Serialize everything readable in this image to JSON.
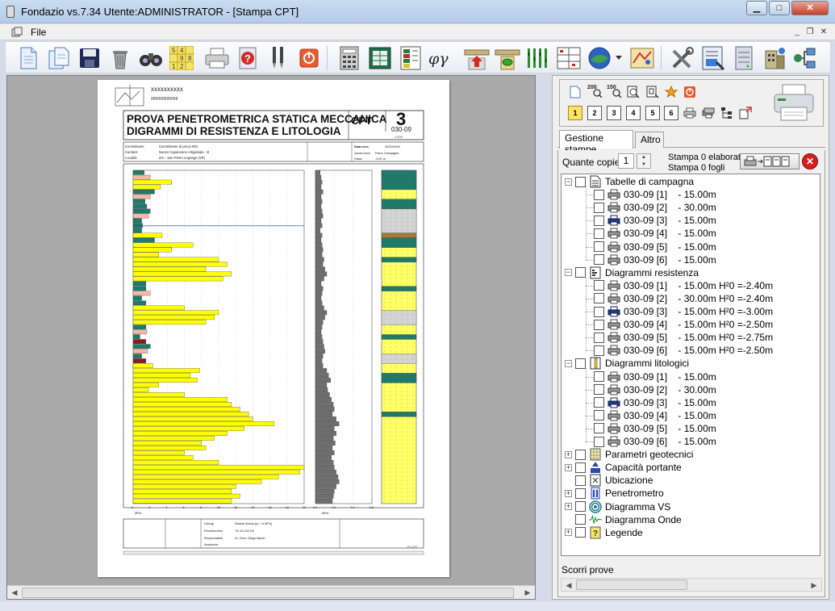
{
  "window": {
    "title": "Fondazio vs.7.34  Utente:ADMINISTRATOR - [Stampa CPT]",
    "minimize_label": "▁",
    "maximize_label": "□",
    "close_label": "✕"
  },
  "menu": {
    "file_label": "File",
    "mdi_minimize": "_",
    "mdi_restore": "❐",
    "mdi_close": "✕"
  },
  "toolbar": {
    "icons": [
      "new-page",
      "copy-pages",
      "save-disk",
      "trash",
      "binoculars",
      "sudoku-grid",
      "printer",
      "help-question",
      "probe-tool",
      "power-button",
      "calculator",
      "table-green",
      "stratigraphy",
      "phi-gamma",
      "penetrometer-red",
      "penetrometer-green",
      "grass-layers",
      "grid-table",
      "globe-dropdown",
      "map",
      "tools",
      "report",
      "server",
      "building",
      "network"
    ],
    "sudoku_digits": [
      "5",
      "4",
      "9",
      "8",
      "1",
      "2"
    ],
    "phi_gamma_label": "φγ"
  },
  "report": {
    "header_brand": "xxxxxxxxxx",
    "header_brand_sub": "gggggggggggg",
    "title_line1": "PROVA PENETROMETRICA STATICA MECCANICA",
    "title_line2": "DIGRAMMI DI RESISTENZA E LITOLOGIA",
    "cpt_label": "CPT",
    "cpt_number": "3",
    "doc_code": "030-09",
    "scale_label": "1:100",
    "committente_label": "Committente",
    "committente": "Committente di prova 000",
    "cantiere_label": "Cantiere",
    "cantiere": "Nuovo Capannone Artigianale - B",
    "localita_label": "Località",
    "localita": "ZAI - San Pietro Legnago (VR)",
    "data_label": "Data esec.",
    "data": "00/00/0000",
    "quota_label": "Quota inizio",
    "quota": "Piano Campagna",
    "falda_label": "Falda",
    "falda": "-3.00 m",
    "bottom_litologi_label": "Litologi",
    "bottom_litologi": "Sabbia limosa (rp = 8 MPa)",
    "bottom_penetrometro_label": "Penetrometro",
    "bottom_penetrometro": "TG 63-200 kN",
    "bottom_responsabile_label": "Responsabile",
    "bottom_responsabile": "Dr. Geol. Diego Martin",
    "bottom_assistente_label": "Assistente",
    "footer_code": "FC-CPT",
    "axis1_label": "MPa",
    "axis2_label": "MPa",
    "axis1_ticks": [
      "0",
      "2",
      "4",
      "6",
      "8",
      "10",
      "12",
      "14",
      "16",
      "18",
      "20"
    ],
    "axis2_ticks": [
      "0.0",
      "0.2",
      "0.4",
      "0.6"
    ],
    "qc_values": [
      1.3,
      2.0,
      4.5,
      3.2,
      2.5,
      2.0,
      1.4,
      1.6,
      2.0,
      1.8,
      1.0,
      1.1,
      1.0,
      3.4,
      2.5,
      7.0,
      4.5,
      3.0,
      10.0,
      11.0,
      8.5,
      11.5,
      10.5,
      1.5,
      1.5,
      2.0,
      1.0,
      1.5,
      6.0,
      10.0,
      9.5,
      8.5,
      1.5,
      1.6,
      0.8,
      1.5,
      2.0,
      1.7,
      1.0,
      1.5,
      2.3,
      7.8,
      6.7,
      7.5,
      3.0,
      1.8,
      6.0,
      11.0,
      11.5,
      12.5,
      13.5,
      14.0,
      16.5,
      13.0,
      11.0,
      9.5,
      8.0,
      8.5,
      6.0,
      7.0,
      10.0,
      20.0,
      19.5,
      17.0,
      15.0,
      12.0,
      11.5,
      12.5,
      11.5
    ],
    "fs_values": [
      0.05,
      0.06,
      0.07,
      0.06,
      0.08,
      0.06,
      0.07,
      0.06,
      0.07,
      0.08,
      0.06,
      0.07,
      0.05,
      0.07,
      0.06,
      0.07,
      0.08,
      0.07,
      0.09,
      0.08,
      0.1,
      0.12,
      0.09,
      0.06,
      0.08,
      0.07,
      0.06,
      0.07,
      0.09,
      0.12,
      0.1,
      0.08,
      0.07,
      0.06,
      0.07,
      0.08,
      0.09,
      0.1,
      0.08,
      0.07,
      0.08,
      0.12,
      0.14,
      0.16,
      0.12,
      0.13,
      0.15,
      0.17,
      0.19,
      0.2,
      0.18,
      0.22,
      0.25,
      0.2,
      0.22,
      0.19,
      0.21,
      0.18,
      0.2,
      0.17,
      0.19,
      0.2,
      0.22,
      0.24,
      0.25,
      0.22,
      0.2,
      0.19,
      0.18
    ]
  },
  "right_panel": {
    "tab_active": "Gestione stampe",
    "tab_other": "Altro",
    "copies_label": "Quante copie",
    "copies_value": "1",
    "stampa_elaborati": "Stampa 0 elaborati",
    "stampa_fogli": "Stampa 0 fogli",
    "panel_icons": [
      "page",
      "zoom-200",
      "zoom-150",
      "zoom-fit",
      "zoom-page",
      "star",
      "power"
    ],
    "zoom_labels": [
      "200",
      "150"
    ],
    "page_numbers": [
      "1",
      "2",
      "3",
      "4",
      "5",
      "6"
    ],
    "scorri_label": "Scorri prove",
    "tree": [
      {
        "label": "Tabelle di campagna",
        "expanded": true,
        "icon": "page-table-icon",
        "children": [
          "030-09 [1]    - 15.00m",
          "030-09 [2]    - 30.00m",
          "030-09 [3]    - 15.00m",
          "030-09 [4]    - 15.00m",
          "030-09 [5]    - 15.00m",
          "030-09 [6]    - 15.00m"
        ]
      },
      {
        "label": "Diagrammi resistenza",
        "expanded": true,
        "icon": "resistance-chart-icon",
        "children": [
          "030-09 [1]    - 15.00m H²0 =-2.40m",
          "030-09 [2]    - 30.00m H²0 =-2.40m",
          "030-09 [3]    - 15.00m H²0 =-3.00m",
          "030-09 [4]    - 15.00m H²0 =-2.50m",
          "030-09 [5]    - 15.00m H²0 =-2.75m",
          "030-09 [6]    - 15.00m H²0 =-2.50m"
        ]
      },
      {
        "label": "Diagrammi litologici",
        "expanded": true,
        "icon": "lithology-chart-icon",
        "children": [
          "030-09 [1]    - 15.00m",
          "030-09 [2]    - 30.00m",
          "030-09 [3]    - 15.00m",
          "030-09 [4]    - 15.00m",
          "030-09 [5]    - 15.00m",
          "030-09 [6]    - 15.00m"
        ]
      },
      {
        "label": "Parametri geotecnici",
        "expanded": false,
        "icon": "geotech-params-icon",
        "children": []
      },
      {
        "label": "Capacità portante",
        "expanded": false,
        "icon": "bearing-capacity-icon",
        "children": []
      },
      {
        "label": "Ubicazione",
        "expanded": null,
        "icon": "location-icon",
        "children": []
      },
      {
        "label": "Penetrometro",
        "expanded": false,
        "icon": "penetrometer-icon",
        "children": []
      },
      {
        "label": "Diagramma VS",
        "expanded": false,
        "icon": "vs-diagram-icon",
        "children": []
      },
      {
        "label": "Diagramma Onde",
        "expanded": null,
        "icon": "wave-diagram-icon",
        "children": []
      },
      {
        "label": "Legende",
        "expanded": false,
        "icon": "legend-icon",
        "children": []
      }
    ]
  }
}
